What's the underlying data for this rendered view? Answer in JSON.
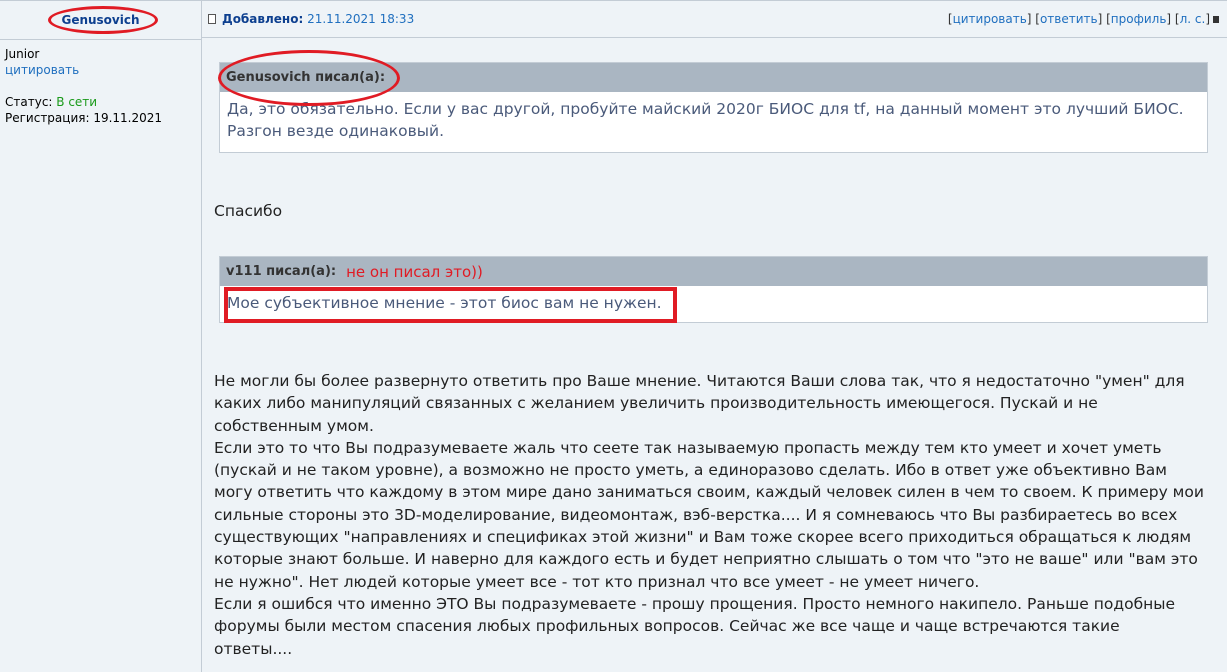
{
  "author": {
    "name": "Genusovich",
    "rank": "Junior",
    "quote_link": "цитировать",
    "status_label": "Статус: ",
    "status_value": "В сети",
    "registration": "Регистрация: 19.11.2021"
  },
  "post_header": {
    "added_label": "Добавлено:",
    "added_date": "21.11.2021 18:33",
    "actions": [
      "цитировать",
      "ответить",
      "профиль",
      "л. с."
    ]
  },
  "quote1": {
    "author": "Genusovich писал(а):",
    "text": "Да, это обязательно. Если у вас другой, пробуйте майский 2020г БИОС для tf, на данный момент это лучший БИОС. Разгон везде одинаковый."
  },
  "thanks": "Спасибо",
  "quote2": {
    "author": "v111 писал(а):",
    "note": "не он писал это))",
    "text": "Мое субъективное мнение - этот биос вам не нужен."
  },
  "main_text": "Не могли бы более развернуто ответить про Ваше мнение. Читаются Ваши слова так, что я недостаточно \"умен\" для\nкаких либо манипуляций связанных с желанием увеличить производительность имеющегося. Пускай и не\nсобственным умом.\nЕсли это то что Вы подразумеваете жаль что сеете так называемую пропасть между тем кто умеет и хочет уметь\n(пускай и не таком уровне), а возможно не просто уметь, а единоразово сделать. Ибо в ответ уже объективно Вам\nмогу ответить что каждому в этом мире дано заниматься своим, каждый человек силен в чем то своем. К примеру мои\nсильные стороны это 3D-моделирование, видеомонтаж, вэб-верстка.... И я сомневаюсь что Вы разбираетесь во всех\nсуществующих \"направлениях и спецификах этой жизни\" и Вам тоже скорее всего приходиться обращаться к людям\nкоторые знают больше. И наверно для каждого есть и будет неприятно слышать о том что \"это не ваше\" или \"вам это\nне нужно\". Нет людей которые умеет все - тот кто признал что все умеет - не умеет ничего.\nЕсли я ошибся что именно ЭТО Вы подразумеваете - прошу прощения. Просто немного накипело. Раньше подобные\nфорумы были местом спасения любых профильных вопросов. Сейчас же все чаще и чаще встречаются такие\nответы...."
}
